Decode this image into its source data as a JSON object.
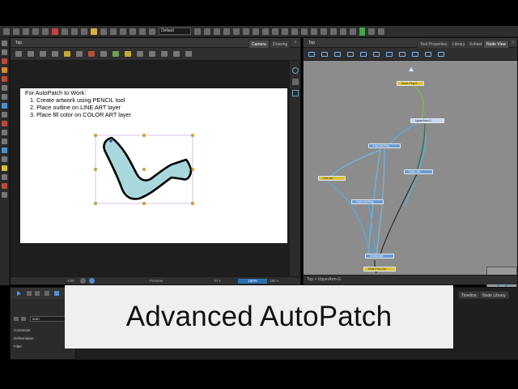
{
  "toolbar": {
    "scene_select_value": "Default"
  },
  "camera_panel": {
    "breadcrumb": "Top",
    "tabs": [
      "Camera",
      "Drawing"
    ],
    "status": {
      "frame_label": "Fr 1",
      "coords": "4/40",
      "preview_label": "Preview",
      "zoom": "100%",
      "angle": "180 A"
    }
  },
  "instructions": {
    "title": "For AutoPatch to Work:",
    "steps": [
      "1. Create artwork using PENCIL tool",
      "2. Place outline on LINE ART layer",
      "3. Place fill color on COLOR ART layer"
    ]
  },
  "artwork": {
    "fill_color": "#a8d8dc",
    "outline_color": "#000000",
    "selection_color": "#b89be0"
  },
  "node_panel": {
    "breadcrumb": "Top",
    "tabs": [
      "Tool Properties",
      "Library",
      "Xsheet",
      "Node View"
    ],
    "path": "Top > UpperArm-G",
    "nodes": [
      {
        "label": "Node-Peg-G",
        "color": "yellow"
      },
      {
        "label": "UpperArm-G",
        "color": "selected"
      },
      {
        "label": "Line-Art-Peg",
        "color": "blue"
      },
      {
        "label": "Line-Art",
        "color": "yellow"
      },
      {
        "label": "Color-Art",
        "color": "blue"
      },
      {
        "label": "Color-Art-Peg",
        "color": "blue"
      },
      {
        "label": "Composite",
        "color": "blue"
      },
      {
        "label": "Multi-Port-Out",
        "color": "yellow"
      }
    ]
  },
  "bottom": {
    "search_value": "auto",
    "properties": [
      "Constraint",
      "Deformation",
      "Filter"
    ],
    "tabs": [
      "Timeline",
      "Node Library"
    ]
  },
  "banner": {
    "title": "Advanced AutoPatch"
  }
}
